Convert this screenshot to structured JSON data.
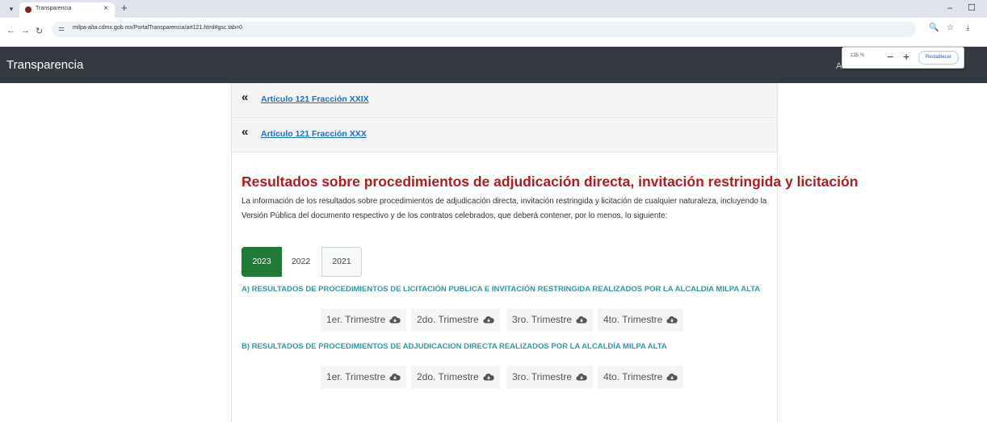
{
  "browser": {
    "tab_title": "Transparencia",
    "url": "milpa-alta.cdmx.gob.mx/PortalTransparencia/art121.html#gsc.tab=0"
  },
  "site": {
    "brand": "Transparencia",
    "nav_fragments": "Alc"
  },
  "zoom": {
    "percent": "125 %",
    "minus": "−",
    "plus": "+",
    "reset_label": "Restablecer"
  },
  "links": [
    {
      "label": "Artículo 121 Fracción XXIX"
    },
    {
      "label": "Artículo 121 Fracción XXX"
    }
  ],
  "main": {
    "heading": "Resultados sobre procedimientos de adjudicación directa, invitación restringida y licitación",
    "intro": "La información de los resultados sobre procedimientos de adjudicación directa, invitación restringida y licitación de cualquier naturaleza, incluyendo la Versión Pública del documento respectivo y de los contratos celebrados, que deberá contener, por lo menos, lo siguiente:",
    "years": [
      "2023",
      "2022",
      "2021"
    ],
    "section_a": "A) RESULTADOS DE PROCEDIMIENTOS DE LICITACIÓN PUBLICA E INVITACIÓN RESTRINGIDA REALIZADOS POR LA ALCALDIA MILPA ALTA",
    "section_b": "B) RESULTADOS DE PROCEDIMIENTOS DE ADJUDICACION DIRECTA REALIZADOS POR LA ALCALDÍA MILPA ALTA",
    "quarters": [
      "1er. Trimestre",
      "2do. Trimestre",
      "3ro. Trimestre",
      "4to. Trimestre"
    ]
  },
  "colors": {
    "heading": "#b01b1b",
    "section": "#2f9aa2",
    "active_year": "#1f7a33",
    "header_bg": "#343a40",
    "link": "#1a6ed8"
  }
}
